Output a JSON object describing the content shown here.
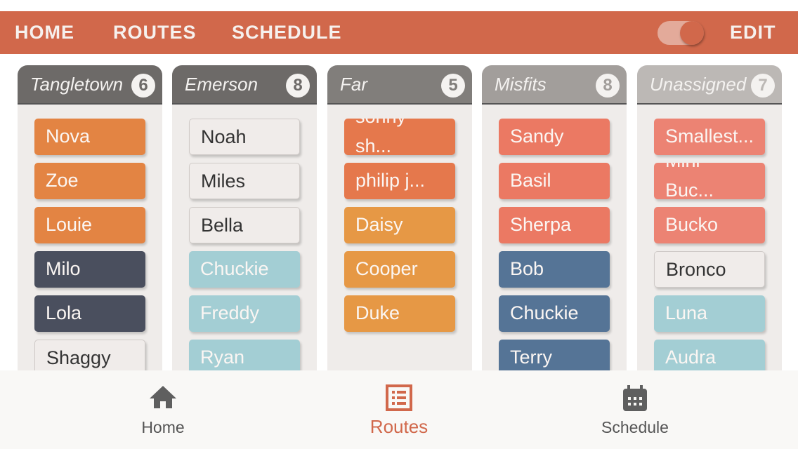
{
  "header": {
    "nav": [
      "HOME",
      "ROUTES",
      "SCHEDULE"
    ],
    "edit_label": "EDIT",
    "edit_toggle_on": true,
    "accent": "#d1684b"
  },
  "columns": [
    {
      "title": "Tangletown",
      "count": "6",
      "head_color": "#6d6a68",
      "badge_color": "#6d6a68",
      "cards": [
        {
          "name": "Nova",
          "color": "#e38443"
        },
        {
          "name": "Zoe",
          "color": "#e38443"
        },
        {
          "name": "Louie",
          "color": "#e38443"
        },
        {
          "name": "Milo",
          "color": "#4a4f5e"
        },
        {
          "name": "Lola",
          "color": "#4a4f5e"
        },
        {
          "name": "Shaggy",
          "color": "plain"
        }
      ]
    },
    {
      "title": "Emerson",
      "count": "8",
      "head_color": "#6d6a68",
      "badge_color": "#6d6a68",
      "cards": [
        {
          "name": "Noah",
          "color": "plain"
        },
        {
          "name": "Miles",
          "color": "plain"
        },
        {
          "name": "Bella",
          "color": "plain"
        },
        {
          "name": "Chuckie",
          "color": "#a3ced4"
        },
        {
          "name": "Freddy",
          "color": "#a3ced4"
        },
        {
          "name": "Ryan",
          "color": "#a3ced4"
        }
      ]
    },
    {
      "title": "Far",
      "count": "5",
      "head_color": "#817e7b",
      "badge_color": "#817e7b",
      "cards": [
        {
          "name": "sonny sh...",
          "color": "#e5784c",
          "two_line": true
        },
        {
          "name": "philip j...",
          "color": "#e5784c"
        },
        {
          "name": "Daisy",
          "color": "#e69845"
        },
        {
          "name": "Cooper",
          "color": "#e69845"
        },
        {
          "name": "Duke",
          "color": "#e69845"
        }
      ]
    },
    {
      "title": "Misfits",
      "count": "8",
      "head_color": "#a29e9b",
      "badge_color": "#a29e9b",
      "cards": [
        {
          "name": "Sandy",
          "color": "#eb7963"
        },
        {
          "name": "Basil",
          "color": "#eb7963"
        },
        {
          "name": "Sherpa",
          "color": "#eb7963"
        },
        {
          "name": "Bob",
          "color": "#557496"
        },
        {
          "name": "Chuckie",
          "color": "#557496"
        },
        {
          "name": "Terry",
          "color": "#557496"
        }
      ]
    },
    {
      "title": "Unassigned",
      "count": "7",
      "head_color": "#bcb8b5",
      "badge_color": "#bcb8b5",
      "cards": [
        {
          "name": "Smallest...",
          "color": "#ec8373"
        },
        {
          "name": "Mini Buc...",
          "color": "#ec8373",
          "two_line": true
        },
        {
          "name": "Bucko",
          "color": "#ec8373"
        },
        {
          "name": "Bronco",
          "color": "plain"
        },
        {
          "name": "Luna",
          "color": "#a3ced4"
        },
        {
          "name": "Audra",
          "color": "#a3ced4"
        }
      ]
    }
  ],
  "tabbar": {
    "tabs": [
      {
        "label": "Home",
        "icon": "home-icon",
        "active": false
      },
      {
        "label": "Routes",
        "icon": "list-icon",
        "active": true
      },
      {
        "label": "Schedule",
        "icon": "calendar-icon",
        "active": false
      }
    ]
  }
}
